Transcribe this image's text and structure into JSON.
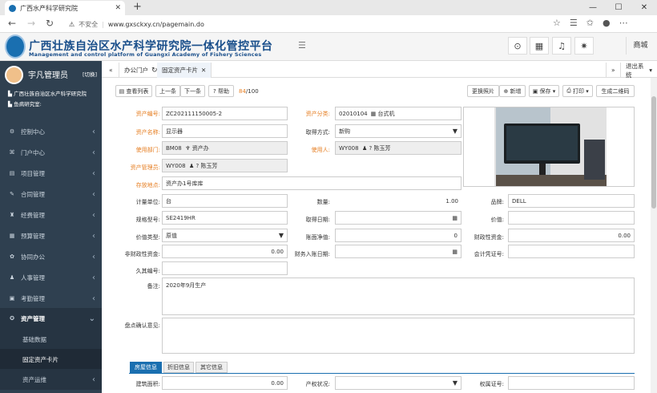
{
  "browser": {
    "tab_title": "广西水产科学研究院",
    "insecure": "不安全",
    "url": "www.gxsckxy.cn/pagemain.do"
  },
  "header": {
    "title_cn": "广西壮族自治区水产科学研究院一体化管控平台",
    "title_en": "Management and control platform of Guangxi Academy of Fishery Sciences",
    "mall": "商城"
  },
  "user": {
    "name": "宇凡管理员",
    "switch": "[切换]",
    "org": "广西壮族自治区水产科学研究院",
    "dept": "鱼病研究室:"
  },
  "menu": [
    {
      "label": "控制中心",
      "icon": "⚙"
    },
    {
      "label": "门户中心",
      "icon": "⌘"
    },
    {
      "label": "项目管理",
      "icon": "▤"
    },
    {
      "label": "合同管理",
      "icon": "✎"
    },
    {
      "label": "经费管理",
      "icon": "♜"
    },
    {
      "label": "预算管理",
      "icon": "▦"
    },
    {
      "label": "协同办公",
      "icon": "✿"
    },
    {
      "label": "人事管理",
      "icon": "♟"
    },
    {
      "label": "考勤管理",
      "icon": "▣"
    },
    {
      "label": "资产管理",
      "icon": "✪"
    },
    {
      "label": "基础数据"
    },
    {
      "label": "固定资产卡片"
    },
    {
      "label": "资产运维",
      "icon": ""
    }
  ],
  "tabs": {
    "office": "办公门户",
    "card": "固定资产卡片",
    "logout": "退出系统"
  },
  "toolbar": {
    "list": "查看列表",
    "prev": "上一条",
    "next": "下一条",
    "help": "帮助",
    "counter_cur": "84",
    "counter_total": "/100",
    "photo": "更换照片",
    "add": "新增",
    "save": "保存",
    "print": "打印",
    "qrcode": "生成二维码"
  },
  "form": {
    "asset_no_label": "资产编号:",
    "asset_no": "ZC202111150005-2",
    "asset_class_label": "资产分类:",
    "asset_class_code": "02010104",
    "asset_class": "台式机",
    "asset_name_label": "资产名称:",
    "asset_name": "显示器",
    "acq_method_label": "取得方式:",
    "acq_method": "新购",
    "use_dept_label": "使用部门:",
    "use_dept_code": "BM08",
    "use_dept": "资产办",
    "user_label": "使用人:",
    "user_code": "WY008",
    "user": "陈玉芳",
    "manager_label": "资产管理员:",
    "manager_code": "WY008",
    "manager": "陈玉芳",
    "location_label": "存放地点:",
    "location": "资产办1号库库",
    "unit_label": "计量单位:",
    "unit": "台",
    "qty_label": "数量:",
    "qty": "1.00",
    "brand_label": "品牌:",
    "brand": "DELL",
    "model_label": "规格型号:",
    "model": "SE2419HR",
    "acq_date_label": "取得日期:",
    "acq_date": "",
    "value_label": "价值:",
    "value": "",
    "value_type_label": "价值类型:",
    "value_type": "原值",
    "net_value_label": "账面净值:",
    "net_value": "0",
    "fiscal_label": "财政性资金:",
    "fiscal": "0.00",
    "nonfiscal_label": "非财政性资金:",
    "nonfiscal": "0.00",
    "entry_date_label": "财务入账日期:",
    "entry_date": "",
    "voucher_label": "会计凭证号:",
    "voucher": "",
    "old_no_label": "久其编号:",
    "old_no": "",
    "remark_label": "备注:",
    "remark": "2020年9月生产",
    "inventory_label": "盘点确认意见:",
    "inventory": ""
  },
  "bottom_tabs": [
    "房屋信息",
    "折旧信息",
    "其它信息"
  ],
  "bottom": {
    "area_label": "建筑面积:",
    "area": "0.00",
    "prop_label": "产权状况:",
    "prop": "",
    "cert_label": "权属证号:",
    "cert": ""
  }
}
